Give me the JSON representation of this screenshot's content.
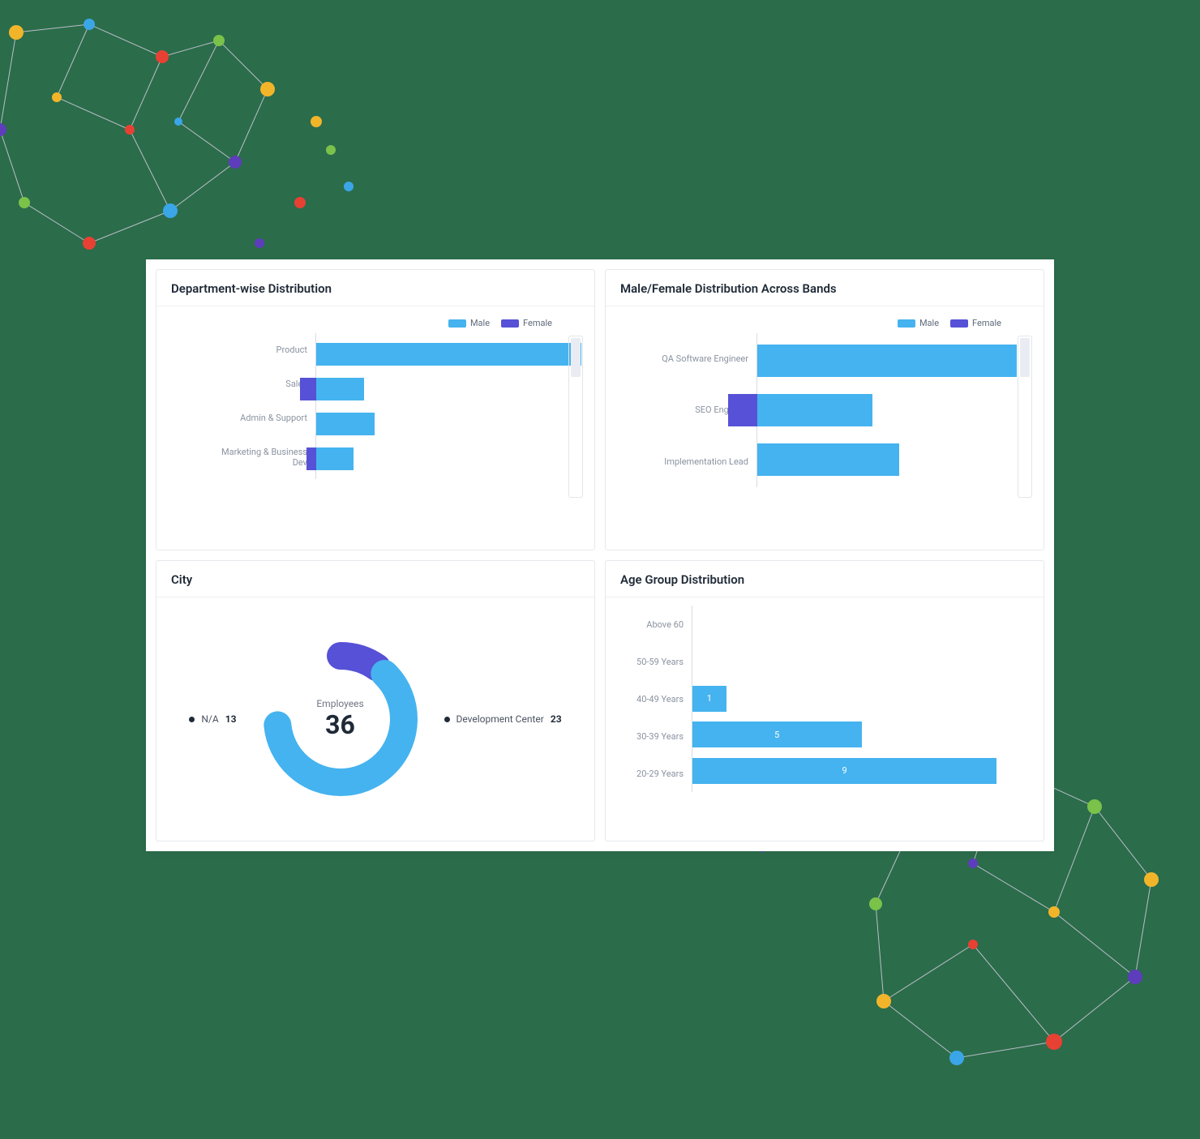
{
  "colors": {
    "male": "#45b3ef",
    "female": "#5651d6"
  },
  "legend": {
    "male": "Male",
    "female": "Female"
  },
  "cards": {
    "dept": {
      "title": "Department-wise Distribution"
    },
    "bands": {
      "title": "Male/Female Distribution Across Bands"
    },
    "city": {
      "title": "City",
      "center_label": "Employees",
      "center_value": "36",
      "slice_a_label": "N/A",
      "slice_a_value": "13",
      "slice_b_label": "Development Center",
      "slice_b_value": "23"
    },
    "age": {
      "title": "Age Group Distribution"
    }
  },
  "chart_data": [
    {
      "id": "dept",
      "type": "bar",
      "orientation": "horizontal",
      "stacked": true,
      "title": "Department-wise Distribution",
      "categories": [
        "Product",
        "Sales",
        "Admin & Support",
        "Marketing & Business Dev"
      ],
      "series": [
        {
          "name": "Male",
          "values": [
            22,
            4,
            5,
            3
          ]
        },
        {
          "name": "Female",
          "values": [
            0,
            2,
            0,
            1
          ]
        }
      ],
      "legend": [
        "Male",
        "Female"
      ]
    },
    {
      "id": "bands",
      "type": "bar",
      "orientation": "horizontal",
      "stacked": true,
      "title": "Male/Female Distribution Across Bands",
      "categories": [
        "QA Software Engineer",
        "SEO Engineer",
        "Implementation Lead"
      ],
      "series": [
        {
          "name": "Male",
          "values": [
            11,
            5,
            6
          ]
        },
        {
          "name": "Female",
          "values": [
            0,
            2,
            0
          ]
        }
      ],
      "legend": [
        "Male",
        "Female"
      ]
    },
    {
      "id": "city",
      "type": "donut",
      "title": "City",
      "center_label": "Employees",
      "center_value": 36,
      "slices": [
        {
          "label": "N/A",
          "value": 13,
          "color": "#5651d6"
        },
        {
          "label": "Development Center",
          "value": 23,
          "color": "#45b3ef"
        }
      ]
    },
    {
      "id": "age",
      "type": "bar",
      "orientation": "horizontal",
      "title": "Age Group Distribution",
      "categories": [
        "Above 60",
        "50-59 Years",
        "40-49 Years",
        "30-39 Years",
        "20-29 Years"
      ],
      "values": [
        0,
        0,
        1,
        5,
        9
      ],
      "xlim": [
        0,
        10
      ]
    }
  ]
}
